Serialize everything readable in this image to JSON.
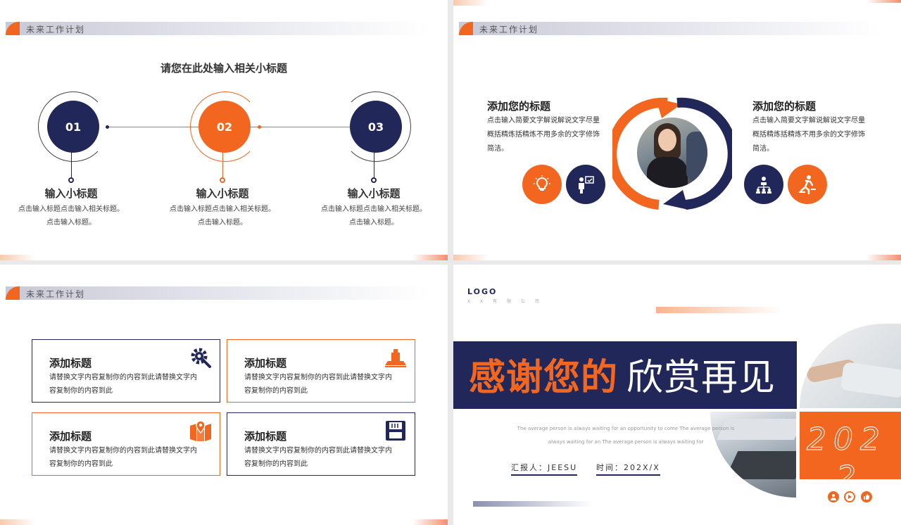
{
  "section_title": "未来工作计划",
  "slide1": {
    "title": "请您在此处输入相关小标题",
    "steps": [
      {
        "num": "01",
        "heading": "输入小标题",
        "text1": "点击输入标题点击输入相关标题。",
        "text2": "点击输入标题。"
      },
      {
        "num": "02",
        "heading": "输入小标题",
        "text1": "点击输入标题点击输入相关标题。",
        "text2": "点击输入标题。"
      },
      {
        "num": "03",
        "heading": "输入小标题",
        "text1": "点击输入标题点击输入相关标题。",
        "text2": "点击输入标题。"
      }
    ]
  },
  "slide2": {
    "left": {
      "heading": "添加您的标题",
      "text": "点击输入简要文字解说解说文字尽量概括精炼括精炼不用多余的文字修饰简洁。"
    },
    "right": {
      "heading": "添加您的标题",
      "text": "点击输入简要文字解说解说文字尽量概括精炼括精炼不用多余的文字修饰简洁。"
    },
    "icons": [
      "lightbulb-icon",
      "presenter-icon",
      "team-icon",
      "runner-icon"
    ]
  },
  "slide3": {
    "boxes": [
      {
        "heading": "添加标题",
        "text": "请替换文字内容复制你的内容到此请替换文字内容复制你的内容到此",
        "icon": "gear-wrench-icon"
      },
      {
        "heading": "添加标题",
        "text": "请替换文字内容复制你的内容到此请替换文字内容复制你的内容到此",
        "icon": "monitor-icon"
      },
      {
        "heading": "添加标题",
        "text": "请替换文字内容复制你的内容到此请替换文字内容复制你的内容到此",
        "icon": "map-pin-icon"
      },
      {
        "heading": "添加标题",
        "text": "请替换文字内容复制你的内容到此请替换文字内容复制你的内容到此",
        "icon": "floppy-icon"
      }
    ]
  },
  "slide4": {
    "logo": "LOGO",
    "company": "X X 有 限 公 司",
    "thanks_orange": "感谢您的",
    "thanks_white": "欣赏再见",
    "en_line1": "The average person is always waiting for an opportunity to come The average person is",
    "en_line2": "always waiting for an The average person is always waiting for",
    "reporter": "汇报人：JEESU",
    "time": "时间：202X/X",
    "year": "202",
    "year2": "2"
  },
  "colors": {
    "orange": "#f2661f",
    "navy": "#22275a"
  }
}
